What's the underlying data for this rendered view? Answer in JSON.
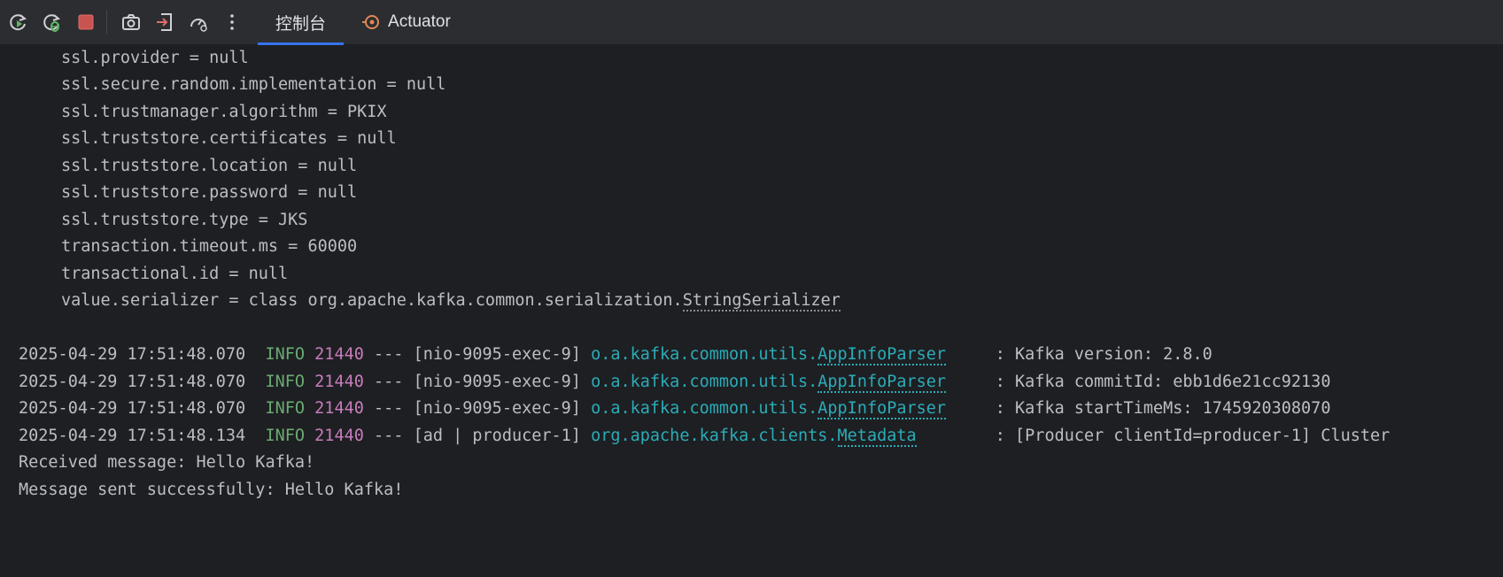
{
  "toolbar": {
    "icons": [
      "rerun-icon",
      "rerun-debug-icon",
      "stop-icon",
      "screenshot-icon",
      "exit-icon",
      "gauge-icon",
      "more-icon"
    ],
    "tabs": [
      {
        "label": "控制台",
        "active": true
      },
      {
        "label": "Actuator",
        "active": false
      }
    ],
    "accent": "#3574f0"
  },
  "console": {
    "config_lines": [
      "ssl.provider = null",
      "ssl.secure.random.implementation = null",
      "ssl.trustmanager.algorithm = PKIX",
      "ssl.truststore.certificates = null",
      "ssl.truststore.location = null",
      "ssl.truststore.password = null",
      "ssl.truststore.type = JKS",
      "transaction.timeout.ms = 60000",
      "transactional.id = null"
    ],
    "serializer_prefix": "value.serializer = class org.apache.kafka.common.serialization.",
    "serializer_class": "StringSerializer",
    "log_entries": [
      {
        "timestamp": "2025-04-29 17:51:48.070",
        "level": "INFO",
        "pid": "21440",
        "sep": "---",
        "thread": "[nio-9095-exec-9]",
        "logger_pkg": "o.a.kafka.common.utils.",
        "logger_class": "AppInfoParser",
        "message": ": Kafka version: 2.8.0"
      },
      {
        "timestamp": "2025-04-29 17:51:48.070",
        "level": "INFO",
        "pid": "21440",
        "sep": "---",
        "thread": "[nio-9095-exec-9]",
        "logger_pkg": "o.a.kafka.common.utils.",
        "logger_class": "AppInfoParser",
        "message": ": Kafka commitId: ebb1d6e21cc92130"
      },
      {
        "timestamp": "2025-04-29 17:51:48.070",
        "level": "INFO",
        "pid": "21440",
        "sep": "---",
        "thread": "[nio-9095-exec-9]",
        "logger_pkg": "o.a.kafka.common.utils.",
        "logger_class": "AppInfoParser",
        "message": ": Kafka startTimeMs: 1745920308070"
      },
      {
        "timestamp": "2025-04-29 17:51:48.134",
        "level": "INFO",
        "pid": "21440",
        "sep": "---",
        "thread": "[ad | producer-1]",
        "logger_pkg": "org.apache.kafka.clients.",
        "logger_class": "Metadata",
        "message": ": [Producer clientId=producer-1] Cluster"
      }
    ],
    "output_lines": [
      "Received message: Hello Kafka!",
      "Message sent successfully: Hello Kafka!"
    ]
  }
}
